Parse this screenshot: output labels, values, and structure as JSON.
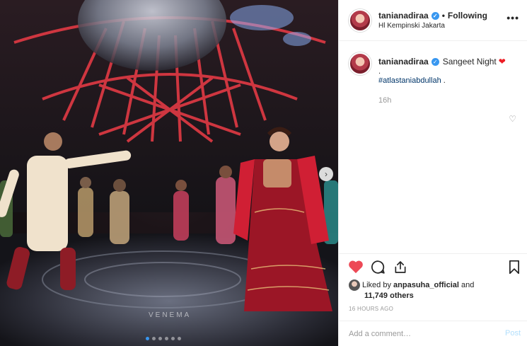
{
  "header": {
    "username": "tanianadiraa",
    "follow_status": "Following",
    "separator": "•",
    "location": "Hl Kempinski Jakarta"
  },
  "caption": {
    "username": "tanianadiraa",
    "text": "Sangeet Night",
    "dot_line": ".",
    "hashtag": "#atlastaniabdullah",
    "hashtag_suffix": " .",
    "time_ago": "16h"
  },
  "likes": {
    "prefix": "Liked by",
    "user": "anpasuha_official",
    "connector": "and",
    "count": "11,749 others",
    "timestamp": "16 HOURS AGO"
  },
  "comment": {
    "placeholder": "Add a comment…",
    "post_label": "Post"
  },
  "photo": {
    "watermark": "VENEMA",
    "carousel_total": 6,
    "carousel_active": 1
  },
  "icons": {
    "verified": "verified-badge-icon",
    "more": "more-options-icon",
    "like": "heart-icon",
    "comment": "comment-icon",
    "share": "share-icon",
    "save": "bookmark-icon"
  },
  "colors": {
    "link_blue": "#3897f0",
    "like_red": "#ed4956",
    "hashtag": "#003569",
    "muted": "#999999"
  }
}
